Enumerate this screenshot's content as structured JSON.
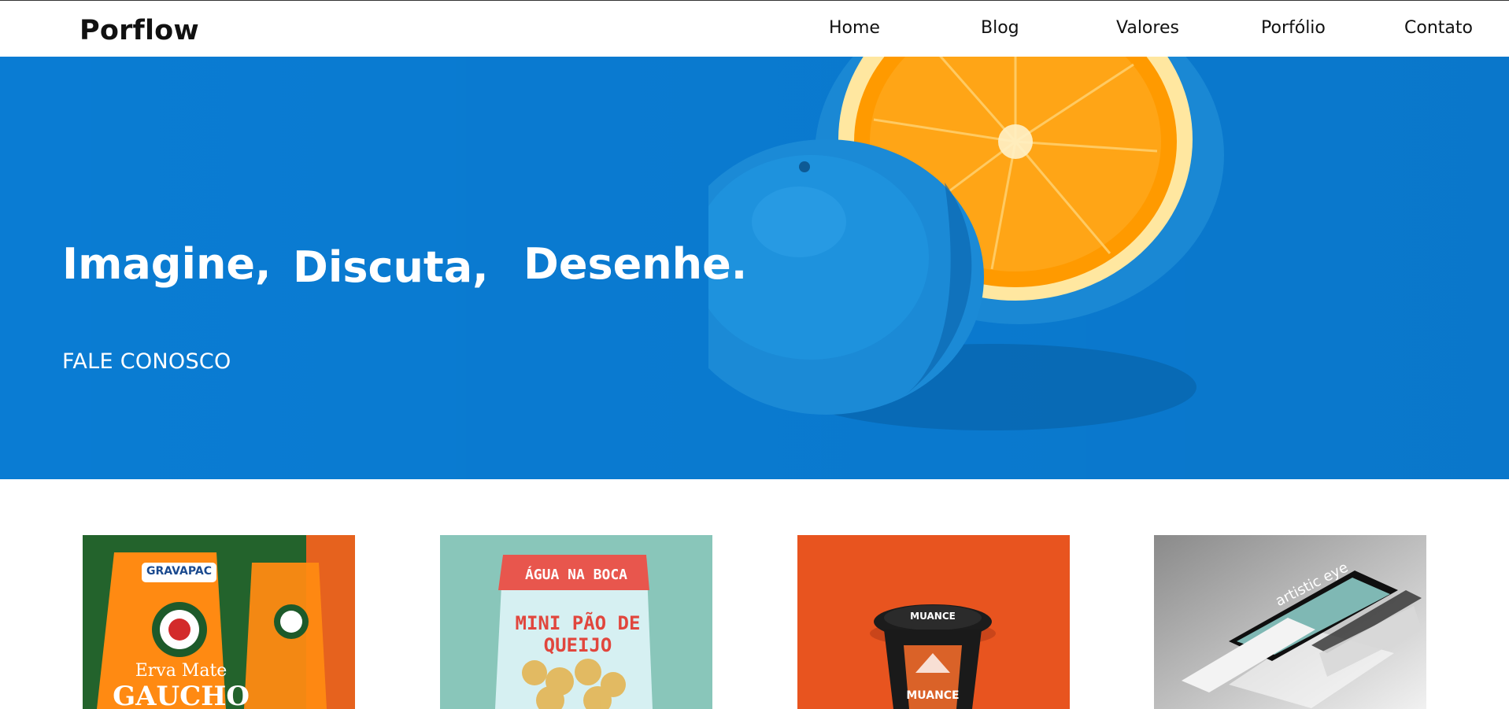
{
  "header": {
    "logo": "Porflow",
    "nav": [
      {
        "label": "Home"
      },
      {
        "label": "Blog"
      },
      {
        "label": "Valores"
      },
      {
        "label": "Porfólio"
      },
      {
        "label": "Contato"
      }
    ]
  },
  "hero": {
    "words": [
      "Imagine,",
      "Discuta,",
      "Desenhe."
    ],
    "cta": "FALE CONOSCO",
    "background_color": "#0a7cd3"
  },
  "portfolio": {
    "items": [
      {
        "name": "erva-mate-gaucho",
        "brand": "GRAVAPAC",
        "title": "Erva Mate",
        "subtitle": "GAUCHO",
        "bg": "#23632c"
      },
      {
        "name": "agua-na-boca",
        "brand": "ÁGUA NA BOCA",
        "title": "MINI PÃO DE QUEIJO",
        "bg": "#89c6ba"
      },
      {
        "name": "muance-cup",
        "brand": "MUANCE",
        "title": "MUANCE",
        "bg": "#e8541f"
      },
      {
        "name": "artistic-eye",
        "title": "artistic eye",
        "bg": "#9a9a9a"
      }
    ]
  }
}
